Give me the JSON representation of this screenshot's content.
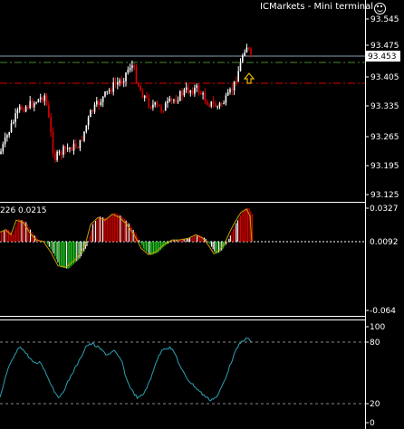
{
  "terminal": {
    "title": "ICMarkets - Mini terminal",
    "icon": "smiley-icon"
  },
  "price_pane": {
    "axis_labels": [
      "93.545",
      "93.475",
      "93.405",
      "93.335",
      "93.265",
      "93.195",
      "93.125"
    ],
    "bid_tag": "93.453",
    "colors": {
      "bull": "#ffffff",
      "bear": "#dd0000",
      "bid_line": "#8a9fb0",
      "support": "#4a8a2a",
      "resistance": "#dd0000",
      "arrow": "#e6b800"
    }
  },
  "histogram_pane": {
    "header": "226 0.0215",
    "axis_labels": [
      "0.0327",
      "0.0092",
      "-0.064"
    ],
    "colors": {
      "up": "#dd0000",
      "down": "#22cc22",
      "signal": "#c8a000",
      "zero": "#ffffff"
    }
  },
  "oscillator_pane": {
    "axis_labels": [
      "100",
      "80",
      "20",
      "0"
    ],
    "colors": {
      "line_up": "#2da0b0",
      "line_down": "#cc3030",
      "levels": "#888888"
    }
  }
}
